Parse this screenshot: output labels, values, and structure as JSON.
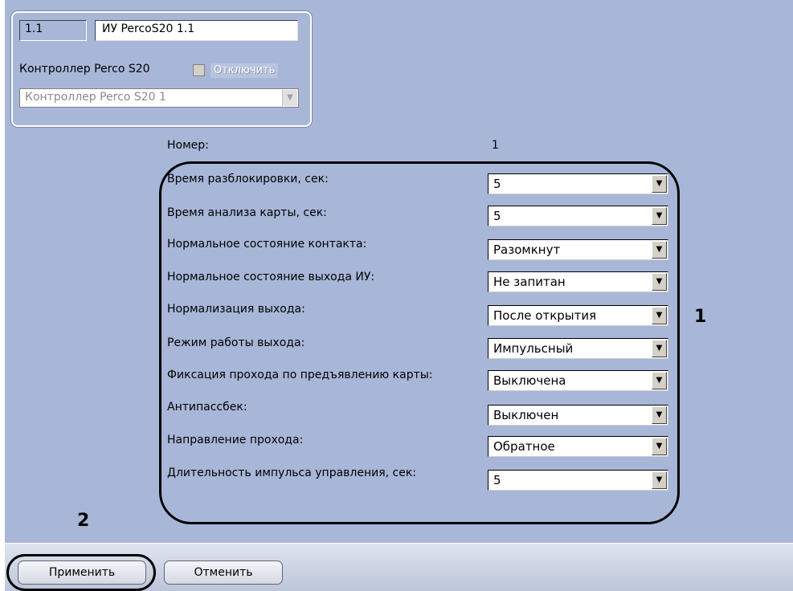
{
  "header": {
    "number": "1.1",
    "name": "ИУ PercoS20 1.1",
    "controller_label": "Контроллер Perco S20",
    "disable_label": "Отключить",
    "disable_checked": false,
    "controller_select": "Контроллер Perco S20 1"
  },
  "form": {
    "number_label": "Номер:",
    "number_value": "1",
    "rows": [
      {
        "label": "Время разблокировки, сек:",
        "value": "5"
      },
      {
        "label": "Время анализа карты, сек:",
        "value": "5"
      },
      {
        "label": "Нормальное состояние контакта:",
        "value": "Разомкнут"
      },
      {
        "label": "Нормальное состояние выхода ИУ:",
        "value": "Не запитан"
      },
      {
        "label": "Нормализация выхода:",
        "value": "После открытия"
      },
      {
        "label": "Режим работы выхода:",
        "value": "Импульсный"
      },
      {
        "label": "Фиксация прохода по предъявлению карты:",
        "value": "Выключена"
      },
      {
        "label": "Антипассбек:",
        "value": "Выключен"
      },
      {
        "label": "Направление прохода:",
        "value": "Обратное"
      },
      {
        "label": "Длительность импульса управления, сек:",
        "value": "5"
      }
    ]
  },
  "callouts": {
    "one": "1",
    "two": "2"
  },
  "buttons": {
    "apply": "Применить",
    "cancel": "Отменить"
  },
  "icons": {
    "dropdown": "chevron-down-icon",
    "checkbox": "checkbox-icon"
  },
  "colors": {
    "panel": "#a8b6d8",
    "highlight_oval": "#000000"
  }
}
